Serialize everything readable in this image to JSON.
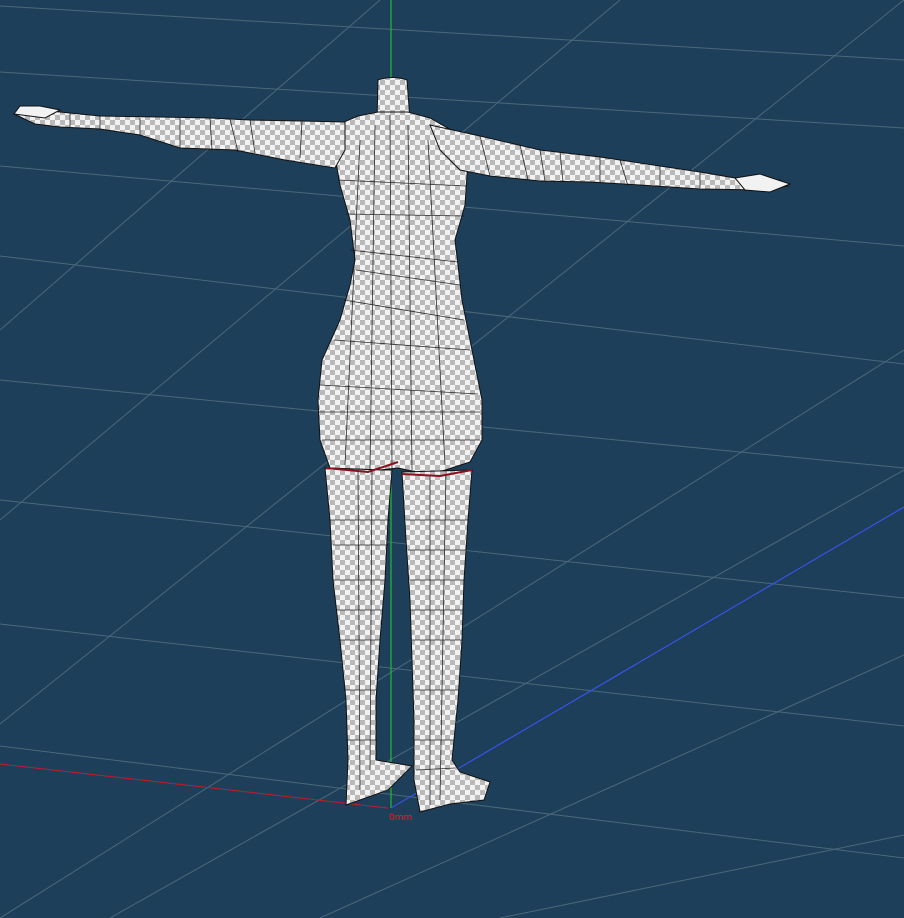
{
  "viewport": {
    "origin_label": "0mm"
  },
  "colors": {
    "background": "#1e3f5a",
    "grid": "#6e8a92",
    "axis_x": "#c81a2a",
    "axis_y": "#20d02a",
    "axis_z": "#3b56ff",
    "mesh_fill": "#f2f2f2",
    "mesh_checker": "#b9b9b9",
    "mesh_wire": "#111111",
    "seam": "#8b1020"
  },
  "icons": {
    "origin": "origin-marker-icon"
  }
}
